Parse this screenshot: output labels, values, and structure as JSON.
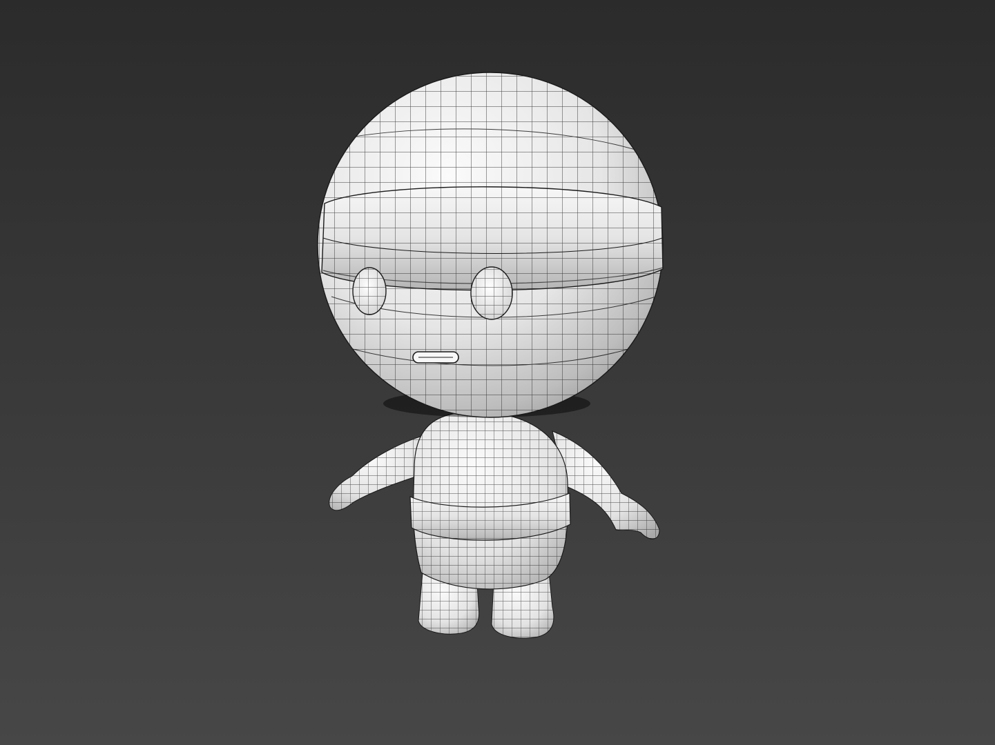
{
  "viewport": {
    "background_top": "#2b2b2b",
    "background_bottom": "#474747",
    "display_mode": "wireframe-on-shaded"
  },
  "model": {
    "subject": "chibi-character-with-beanie",
    "surface_color": "#f2f2f2",
    "wire_color": "#1a1a1a",
    "parts": [
      "head",
      "beanie-cuff",
      "left-eye",
      "right-eye",
      "mouth",
      "torso",
      "pants",
      "left-arm",
      "right-arm",
      "left-leg",
      "right-leg"
    ]
  }
}
